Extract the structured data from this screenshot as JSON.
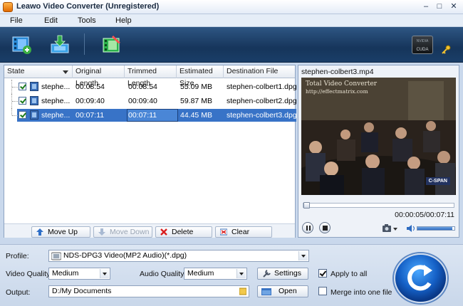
{
  "window": {
    "title": "Leawo Video Converter (Unregistered)",
    "minimize": "–",
    "maximize": "□",
    "close": "✕"
  },
  "menu": [
    "File",
    "Edit",
    "Tools",
    "Help"
  ],
  "toolbar": {
    "cuda_top": "NVIDIA",
    "cuda_label": "CUDA"
  },
  "list": {
    "headers": [
      "State",
      "Original Length",
      "Trimmed Length",
      "Estimated Size",
      "Destination File"
    ],
    "rows": [
      {
        "name": "stephe...",
        "original": "00:08:54",
        "trimmed": "00:08:54",
        "size": "55.09 MB",
        "dest": "stephen-colbert1.dpg"
      },
      {
        "name": "stephe...",
        "original": "00:09:40",
        "trimmed": "00:09:40",
        "size": "59.87 MB",
        "dest": "stephen-colbert2.dpg"
      },
      {
        "name": "stephe...",
        "original": "00:07:11",
        "trimmed": "00:07:11",
        "size": "44.45 MB",
        "dest": "stephen-colbert3.dpg"
      }
    ],
    "buttons": {
      "move_up": "Move Up",
      "move_down": "Move Down",
      "delete": "Delete",
      "clear": "Clear"
    }
  },
  "preview": {
    "title": "stephen-colbert3.mp4",
    "watermark1": "Total Video Converter",
    "watermark2": "http://effectmatrix.com",
    "channel": "C-SPAN",
    "time": "00:00:05/00:07:11",
    "volume_level": 0.95
  },
  "settings": {
    "profile_label": "Profile:",
    "profile_value": "NDS-DPG3 Video(MP2 Audio)(*.dpg)",
    "video_quality_label": "Video Quality:",
    "video_quality_value": "Medium",
    "audio_quality_label": "Audio Quality:",
    "audio_quality_value": "Medium",
    "settings_button": "Settings",
    "apply_to_all": "Apply to all",
    "output_label": "Output:",
    "output_value": "D:/My Documents",
    "open_button": "Open",
    "merge": "Merge into one file"
  }
}
